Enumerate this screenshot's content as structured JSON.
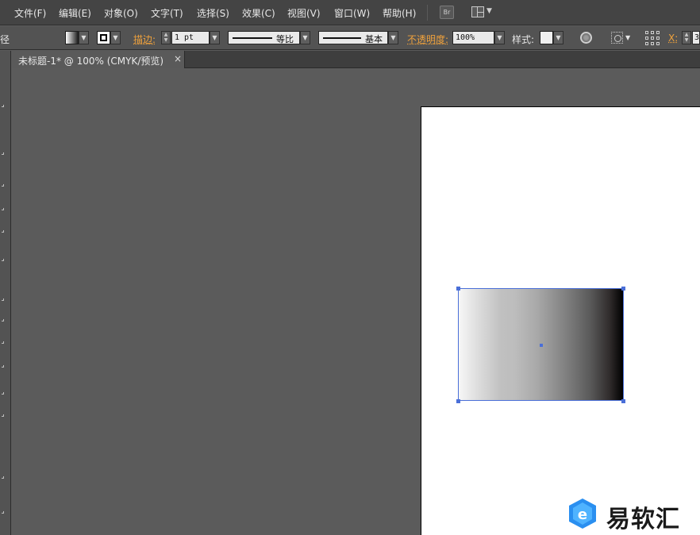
{
  "menu": {
    "items": [
      "文件(F)",
      "编辑(E)",
      "对象(O)",
      "文字(T)",
      "选择(S)",
      "效果(C)",
      "视图(V)",
      "窗口(W)",
      "帮助(H)"
    ],
    "bridge_label": "Br"
  },
  "control": {
    "left_cut_label": "径",
    "stroke_label": "描边:",
    "stroke_weight": "1 pt",
    "profile_label": "等比",
    "brush_label": "基本",
    "opacity_label": "不透明度:",
    "opacity_value": "100%",
    "style_label": "样式:",
    "x_label": "X:",
    "x_value": "3"
  },
  "tab": {
    "title": "未标题-1* @ 100% (CMYK/预览)",
    "close": "×"
  },
  "watermark": {
    "brand": "易软汇"
  },
  "colors": {
    "selection": "#4a6fd8",
    "accent_orange": "#f0a23c"
  }
}
